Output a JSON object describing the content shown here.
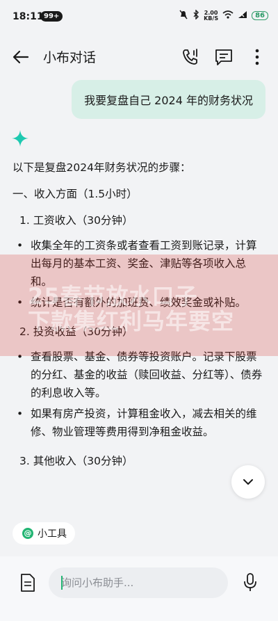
{
  "status_bar": {
    "time": "18:11",
    "notif_badge": "99+",
    "net_speed_value": "2.00",
    "net_speed_unit": "KB/S",
    "battery": "86"
  },
  "header": {
    "title": "小布对话",
    "icons": [
      "back-arrow-icon",
      "voice-call-icon",
      "chat-list-icon",
      "more-icon"
    ]
  },
  "user_message": "我要复盘自己 2024 年的财务状况",
  "assistant": {
    "intro": "以下是复盘2024年财务状况的步骤：",
    "section_1": "一、收入方面（1.5小时）",
    "items": [
      {
        "title": "1. 工资收入（30分钟）",
        "bullets": [
          "收集全年的工资条或者查看工资到账记录，计算出每月的基本工资、奖金、津贴等各项收入总和。",
          "统计是否有额外的加班费、绩效奖金或补贴。"
        ]
      },
      {
        "title": "2. 投资收益（30分钟）",
        "bullets": [
          "查看股票、基金、债券等投资账户。记录下股票的分红、基金的收益（赎回收益、分红等）、债券的利息收入等。",
          "如果有房产投资，计算租金收入，减去相关的维修、物业管理等费用得到净租金收益。"
        ]
      },
      {
        "title": "3. 其他收入（30分钟）"
      }
    ]
  },
  "promo_overlay": {
    "line1": "25春节放水口子",
    "line2": "下款集红利马年要空"
  },
  "tool_chip": {
    "label": "小工具"
  },
  "input": {
    "placeholder": "询问小布助手..."
  },
  "colors": {
    "accent": "#22b573",
    "user_bubble": "#d7efe7",
    "sparkle": "#1ec9b0"
  }
}
